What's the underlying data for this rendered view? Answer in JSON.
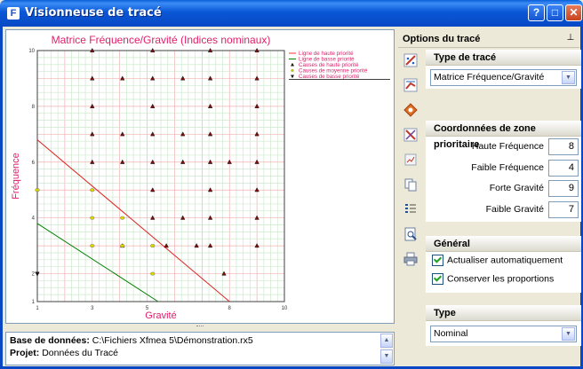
{
  "window": {
    "title": "Visionneuse de tracé",
    "buttons": {
      "help": "?",
      "maximize": "□",
      "close": "✕"
    }
  },
  "chart_data": {
    "type": "scatter",
    "title": "Matrice Fréquence/Gravité (Indices nominaux)",
    "xlabel": "Gravité",
    "ylabel": "Fréquence",
    "xlim": [
      1,
      10
    ],
    "ylim": [
      1,
      10
    ],
    "x_ticks": [
      "1",
      "3",
      "5",
      "8",
      "10"
    ],
    "y_ticks": [
      "1",
      "2",
      "4",
      "6",
      "8",
      "10"
    ],
    "grid": true,
    "legend_position": "top-right",
    "legend": [
      {
        "label": "Ligne de haute priorité",
        "marker": "line",
        "color": "#ff3030"
      },
      {
        "label": "Ligne de basse priorité",
        "marker": "line",
        "color": "#008000"
      },
      {
        "label": "Causes de haute priorité",
        "marker": "triangle-up",
        "color": "#1a1a1a"
      },
      {
        "label": "Causes de moyenne priorité",
        "marker": "circle",
        "color": "#cccc00"
      },
      {
        "label": "Causes de basse priorité",
        "marker": "triangle-down",
        "color": "#1a1a1a"
      }
    ],
    "lines": [
      {
        "name": "Ligne de haute priorité",
        "color": "#e02020",
        "points": [
          [
            1,
            6.8
          ],
          [
            8,
            1
          ]
        ]
      },
      {
        "name": "Ligne de basse priorité",
        "color": "#008000",
        "points": [
          [
            1,
            3.8
          ],
          [
            5.4,
            1
          ]
        ]
      }
    ],
    "series": [
      {
        "name": "Causes de haute priorité",
        "marker": "triangle-up",
        "color": "#7a1010",
        "points": [
          [
            3,
            10
          ],
          [
            5.2,
            10
          ],
          [
            7.3,
            10
          ],
          [
            9,
            10
          ],
          [
            3,
            9
          ],
          [
            4.1,
            9
          ],
          [
            5.2,
            9
          ],
          [
            6.3,
            9
          ],
          [
            7.3,
            9
          ],
          [
            9,
            9
          ],
          [
            3,
            8
          ],
          [
            5.2,
            8
          ],
          [
            7.3,
            8
          ],
          [
            9,
            8
          ],
          [
            3,
            7
          ],
          [
            4.1,
            7
          ],
          [
            5.2,
            7
          ],
          [
            6.3,
            7
          ],
          [
            7.3,
            7
          ],
          [
            9,
            7
          ],
          [
            3,
            6
          ],
          [
            4.1,
            6
          ],
          [
            5.2,
            6
          ],
          [
            6.3,
            6
          ],
          [
            7.3,
            6
          ],
          [
            8,
            6
          ],
          [
            9,
            6
          ],
          [
            5.2,
            5
          ],
          [
            7.3,
            5
          ],
          [
            9,
            5
          ],
          [
            5.2,
            4
          ],
          [
            6.3,
            4
          ],
          [
            7.3,
            4
          ],
          [
            9,
            4
          ],
          [
            4.1,
            3
          ],
          [
            5.7,
            3
          ],
          [
            6.8,
            3
          ],
          [
            7.3,
            3
          ],
          [
            9,
            3
          ],
          [
            7.8,
            2
          ]
        ]
      },
      {
        "name": "Causes de moyenne priorité",
        "marker": "circle",
        "color": "#d8d800",
        "points": [
          [
            1,
            5
          ],
          [
            3,
            5
          ],
          [
            3,
            4
          ],
          [
            4.1,
            4
          ],
          [
            3,
            3
          ],
          [
            4.1,
            3
          ],
          [
            5.2,
            3
          ],
          [
            5.2,
            2
          ]
        ]
      },
      {
        "name": "Causes de basse priorité",
        "marker": "triangle-down",
        "color": "#1a1a1a",
        "points": [
          [
            1,
            2
          ]
        ]
      }
    ]
  },
  "info": {
    "db_label": "Base de données:",
    "db_value": "C:\\Fichiers Xfmea 5\\Démonstration.rx5",
    "project_label": "Projet:",
    "project_value": "Données du Tracé"
  },
  "options": {
    "title": "Options du tracé",
    "tools": [
      "scatter-tool-icon",
      "line-tool-icon",
      "color-tool-icon",
      "axes-tool-icon",
      "data-tool-icon",
      "copy-icon",
      "list-icon",
      "preview-icon",
      "print-icon"
    ],
    "plot_type": {
      "header": "Type de tracé",
      "value": "Matrice Fréquence/Gravité"
    },
    "coords": {
      "header": "Coordonnées de zone prioritaire",
      "fields": [
        {
          "label": "Haute Fréquence",
          "value": "8"
        },
        {
          "label": "Faible Fréquence",
          "value": "4"
        },
        {
          "label": "Forte Gravité",
          "value": "9"
        },
        {
          "label": "Faible Gravité",
          "value": "7"
        }
      ]
    },
    "general": {
      "header": "Général",
      "auto_update": "Actualiser automatiquement",
      "keep_proportions": "Conserver les proportions"
    },
    "type": {
      "header": "Type",
      "value": "Nominal"
    }
  }
}
